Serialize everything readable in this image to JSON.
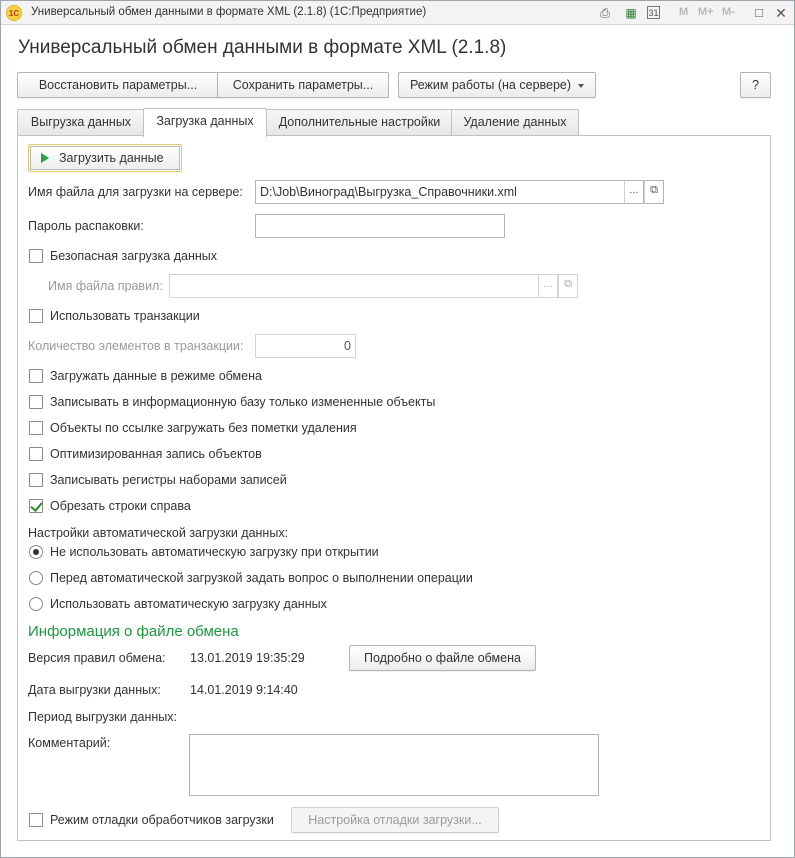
{
  "window": {
    "title": "Универсальный обмен данными в формате XML (2.1.8)  (1С:Предприятие)",
    "logo_text": "1С",
    "toolbar_m": [
      "M",
      "M+",
      "M-"
    ]
  },
  "form": {
    "title": "Универсальный обмен данными в формате XML (2.1.8)"
  },
  "toolbar": {
    "restore_label": "Восстановить параметры...",
    "save_label": "Сохранить параметры...",
    "mode_label": "Режим работы (на сервере)",
    "help_label": "?"
  },
  "tabs": [
    {
      "label": "Выгрузка данных",
      "active": false
    },
    {
      "label": "Загрузка данных",
      "active": true
    },
    {
      "label": "Дополнительные настройки",
      "active": false
    },
    {
      "label": "Удаление данных",
      "active": false
    }
  ],
  "load": {
    "load_button": "Загрузить данные",
    "file_label": "Имя файла для загрузки на сервере:",
    "file_value": "D:\\Job\\Виноград\\Выгрузка_Справочники.xml",
    "choose_btn": "...",
    "open_btn": "⧉",
    "password_label": "Пароль распаковки:",
    "password_value": "",
    "safe_load_label": "Безопасная загрузка данных",
    "rules_file_label": "Имя файла правил:",
    "rules_file_value": "",
    "use_transactions_label": "Использовать транзакции",
    "tx_count_label": "Количество элементов в транзакции:",
    "tx_count_value": "0",
    "checkboxes": [
      {
        "label": "Загружать данные в режиме обмена",
        "checked": false
      },
      {
        "label": "Записывать в информационную базу только измененные объекты",
        "checked": false
      },
      {
        "label": "Объекты по ссылке загружать без пометки удаления",
        "checked": false
      },
      {
        "label": "Оптимизированная запись объектов",
        "checked": false
      },
      {
        "label": "Записывать регистры наборами записей",
        "checked": false
      },
      {
        "label": "Обрезать строки справа",
        "checked": true
      }
    ],
    "auto_label": "Настройки автоматической загрузки данных:",
    "radios": [
      {
        "label": "Не использовать автоматическую загрузку при открытии",
        "checked": true
      },
      {
        "label": "Перед автоматической загрузкой задать вопрос о выполнении операции",
        "checked": false
      },
      {
        "label": "Использовать автоматическую загрузку данных",
        "checked": false
      }
    ]
  },
  "info": {
    "heading": "Информация о файле обмена",
    "rules_version_label": "Версия правил обмена:",
    "rules_version_value": "13.01.2019 19:35:29",
    "details_button": "Подробно о файле обмена",
    "export_date_label": "Дата выгрузки данных:",
    "export_date_value": "14.01.2019 9:14:40",
    "period_label": "Период выгрузки данных:",
    "comment_label": "Комментарий:",
    "comment_value": "",
    "debug_label": "Режим отладки обработчиков загрузки",
    "debug_button": "Настройка отладки загрузки..."
  },
  "colors": {
    "accent_green": "#1b9a3c",
    "focus_border": "#e3c86a"
  }
}
